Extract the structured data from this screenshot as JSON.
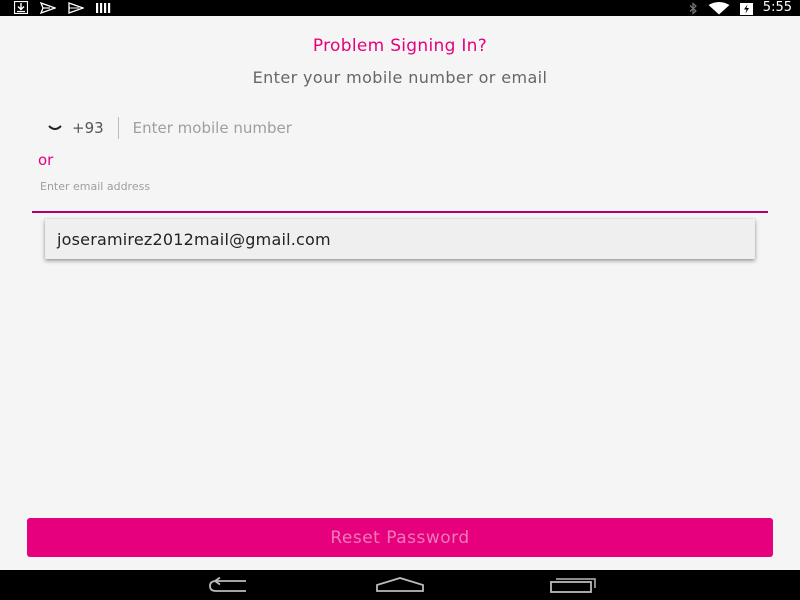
{
  "status_bar": {
    "time": "5:55",
    "left_icons": [
      "download-icon",
      "send-icon",
      "play-store-icon",
      "signal-bars-icon"
    ],
    "right_icons": [
      "bluetooth-icon",
      "wifi-icon",
      "battery-charging-icon"
    ]
  },
  "header": {
    "title": "Problem Signing In?",
    "subtitle": "Enter your mobile number or email"
  },
  "phone": {
    "country_code": "+93",
    "placeholder": "Enter mobile number",
    "value": ""
  },
  "or_label": "or",
  "email": {
    "label": "Enter email address",
    "value": ""
  },
  "autocomplete": {
    "suggestion": "joseramirez2012mail@gmail.com"
  },
  "actions": {
    "reset_label": "Reset Password"
  },
  "colors": {
    "accent": "#e6007e",
    "underline": "#b0006a",
    "status_bar": "#000000"
  },
  "nav_bar": {
    "buttons": [
      "back-icon",
      "home-icon",
      "recents-icon"
    ]
  }
}
